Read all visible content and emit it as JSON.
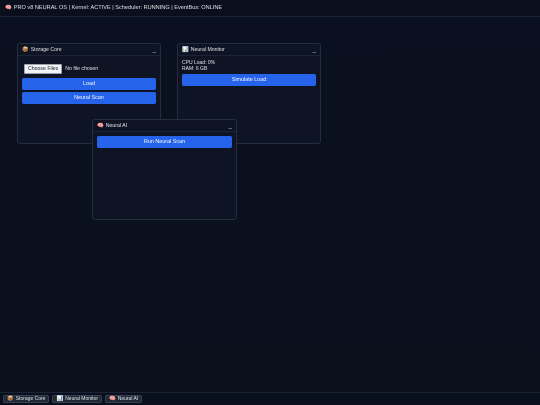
{
  "topbar": {
    "icon": "brain-icon",
    "text": "PRO v8 NEURAL OS | Kernel: ACTIVE | Scheduler: RUNNING | EventBus: ONLINE"
  },
  "windows": {
    "storage": {
      "icon": "box-icon",
      "title": "Storage Core",
      "minimize": "_",
      "choose_files": "Choose Files",
      "file_status": "No file chosen",
      "load_label": "Load",
      "scan_label": "Neural Scan"
    },
    "monitor": {
      "icon": "chart-icon",
      "title": "Neural Monitor",
      "minimize": "_",
      "cpu": "CPU Load: 0%",
      "ram": "RAM: 6 GB",
      "simulate_label": "Simulate Load"
    },
    "ai": {
      "icon": "brain-icon",
      "title": "Neural AI",
      "minimize": "_",
      "run_label": "Run Neural Scan"
    }
  },
  "taskbar": {
    "items": [
      {
        "icon": "box-icon",
        "label": "Storage Core"
      },
      {
        "icon": "chart-icon",
        "label": "Neural Monitor"
      },
      {
        "icon": "brain-icon",
        "label": "Neural AI"
      }
    ]
  },
  "colors": {
    "accent": "#2563eb",
    "background": "#0b1020",
    "window": "#0e1424"
  }
}
